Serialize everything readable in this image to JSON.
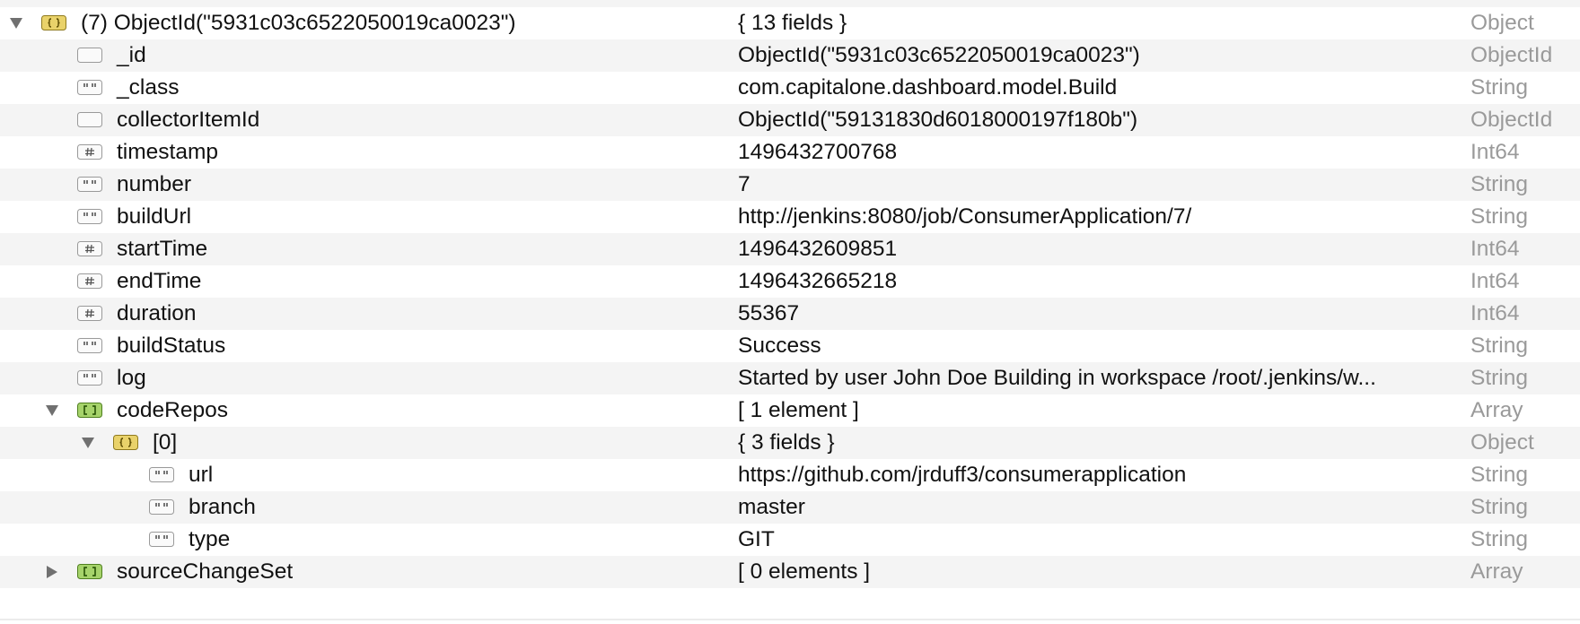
{
  "rows": [
    {
      "depth": 0,
      "disclosure": "expanded",
      "icon": "object-icon",
      "name": "(7) ObjectId(\"5931c03c6522050019ca0023\")",
      "value": "{ 13 fields }",
      "type": "Object"
    },
    {
      "depth": 1,
      "disclosure": "none",
      "icon": "objectid-icon",
      "name": "_id",
      "value": "ObjectId(\"5931c03c6522050019ca0023\")",
      "type": "ObjectId"
    },
    {
      "depth": 1,
      "disclosure": "none",
      "icon": "string-icon",
      "name": "_class",
      "value": "com.capitalone.dashboard.model.Build",
      "type": "String"
    },
    {
      "depth": 1,
      "disclosure": "none",
      "icon": "objectid-icon",
      "name": "collectorItemId",
      "value": "ObjectId(\"59131830d6018000197f180b\")",
      "type": "ObjectId"
    },
    {
      "depth": 1,
      "disclosure": "none",
      "icon": "number-icon",
      "name": "timestamp",
      "value": "1496432700768",
      "type": "Int64"
    },
    {
      "depth": 1,
      "disclosure": "none",
      "icon": "string-icon",
      "name": "number",
      "value": "7",
      "type": "String"
    },
    {
      "depth": 1,
      "disclosure": "none",
      "icon": "string-icon",
      "name": "buildUrl",
      "value": "http://jenkins:8080/job/ConsumerApplication/7/",
      "type": "String"
    },
    {
      "depth": 1,
      "disclosure": "none",
      "icon": "number-icon",
      "name": "startTime",
      "value": "1496432609851",
      "type": "Int64"
    },
    {
      "depth": 1,
      "disclosure": "none",
      "icon": "number-icon",
      "name": "endTime",
      "value": "1496432665218",
      "type": "Int64"
    },
    {
      "depth": 1,
      "disclosure": "none",
      "icon": "number-icon",
      "name": "duration",
      "value": "55367",
      "type": "Int64"
    },
    {
      "depth": 1,
      "disclosure": "none",
      "icon": "string-icon",
      "name": "buildStatus",
      "value": "Success",
      "type": "String"
    },
    {
      "depth": 1,
      "disclosure": "none",
      "icon": "string-icon",
      "name": "log",
      "value": "Started by user John Doe Building in workspace /root/.jenkins/w...",
      "type": "String"
    },
    {
      "depth": 1,
      "disclosure": "expanded",
      "icon": "array-icon",
      "name": "codeRepos",
      "value": "[ 1 element ]",
      "type": "Array"
    },
    {
      "depth": 2,
      "disclosure": "expanded",
      "icon": "object-icon",
      "name": "[0]",
      "value": "{ 3 fields }",
      "type": "Object"
    },
    {
      "depth": 3,
      "disclosure": "none",
      "icon": "string-icon",
      "name": "url",
      "value": "https://github.com/jrduff3/consumerapplication",
      "type": "String"
    },
    {
      "depth": 3,
      "disclosure": "none",
      "icon": "string-icon",
      "name": "branch",
      "value": "master",
      "type": "String"
    },
    {
      "depth": 3,
      "disclosure": "none",
      "icon": "string-icon",
      "name": "type",
      "value": "GIT",
      "type": "String"
    },
    {
      "depth": 1,
      "disclosure": "collapsed",
      "icon": "array-icon",
      "name": "sourceChangeSet",
      "value": "[ 0 elements ]",
      "type": "Array"
    }
  ],
  "colors": {
    "row_alt": "#f4f4f4",
    "object_icon_fill": "#e9d26a",
    "array_icon_fill": "#a6d36b",
    "type_text": "#9a9a9a"
  }
}
